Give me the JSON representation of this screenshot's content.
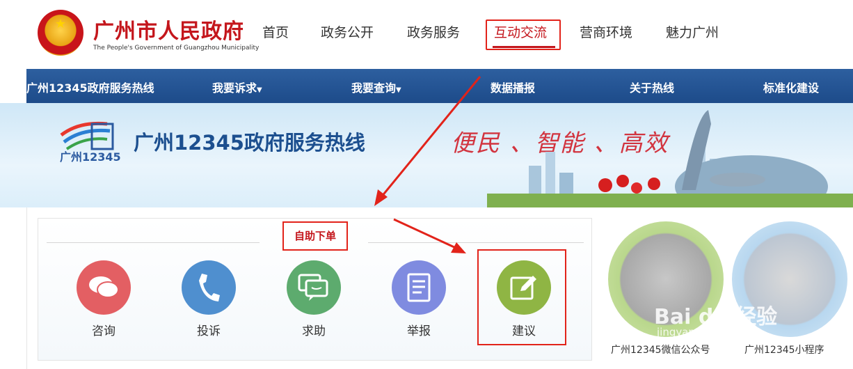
{
  "header": {
    "title": "广州市人民政府",
    "subtitle": "The People's Government of Guangzhou Municipality",
    "nav": [
      "首页",
      "政务公开",
      "政务服务",
      "互动交流",
      "营商环境",
      "魅力广州"
    ],
    "active_nav": "互动交流"
  },
  "subnav": {
    "brand": "广州12345政府服务热线",
    "items": [
      "我要诉求",
      "我要查询",
      "数据播报",
      "关于热线",
      "标准化建设"
    ]
  },
  "banner": {
    "logo_text": "广州12345",
    "title": "广州12345政府服务热线",
    "slogan": "便民 、智能 、高效"
  },
  "panel": {
    "tag": "自助下单",
    "services": [
      {
        "label": "咨询",
        "icon": "chat-bubbles-icon",
        "color": "#e35f63"
      },
      {
        "label": "投诉",
        "icon": "phone-icon",
        "color": "#4f8fcf"
      },
      {
        "label": "求助",
        "icon": "message-icon",
        "color": "#5dab6e"
      },
      {
        "label": "举报",
        "icon": "document-icon",
        "color": "#7f8be0"
      },
      {
        "label": "建议",
        "icon": "edit-icon",
        "color": "#8fb544"
      }
    ]
  },
  "qr": {
    "wechat_label": "广州12345微信公众号",
    "miniprogram_label": "广州12345小程序"
  },
  "watermark": {
    "text": "Bai du 经验",
    "url": "jingyan.baidu.com"
  },
  "colors": {
    "brand_red": "#c4161c",
    "nav_blue": "#1d4b8a",
    "annotation_red": "#e2231a"
  }
}
